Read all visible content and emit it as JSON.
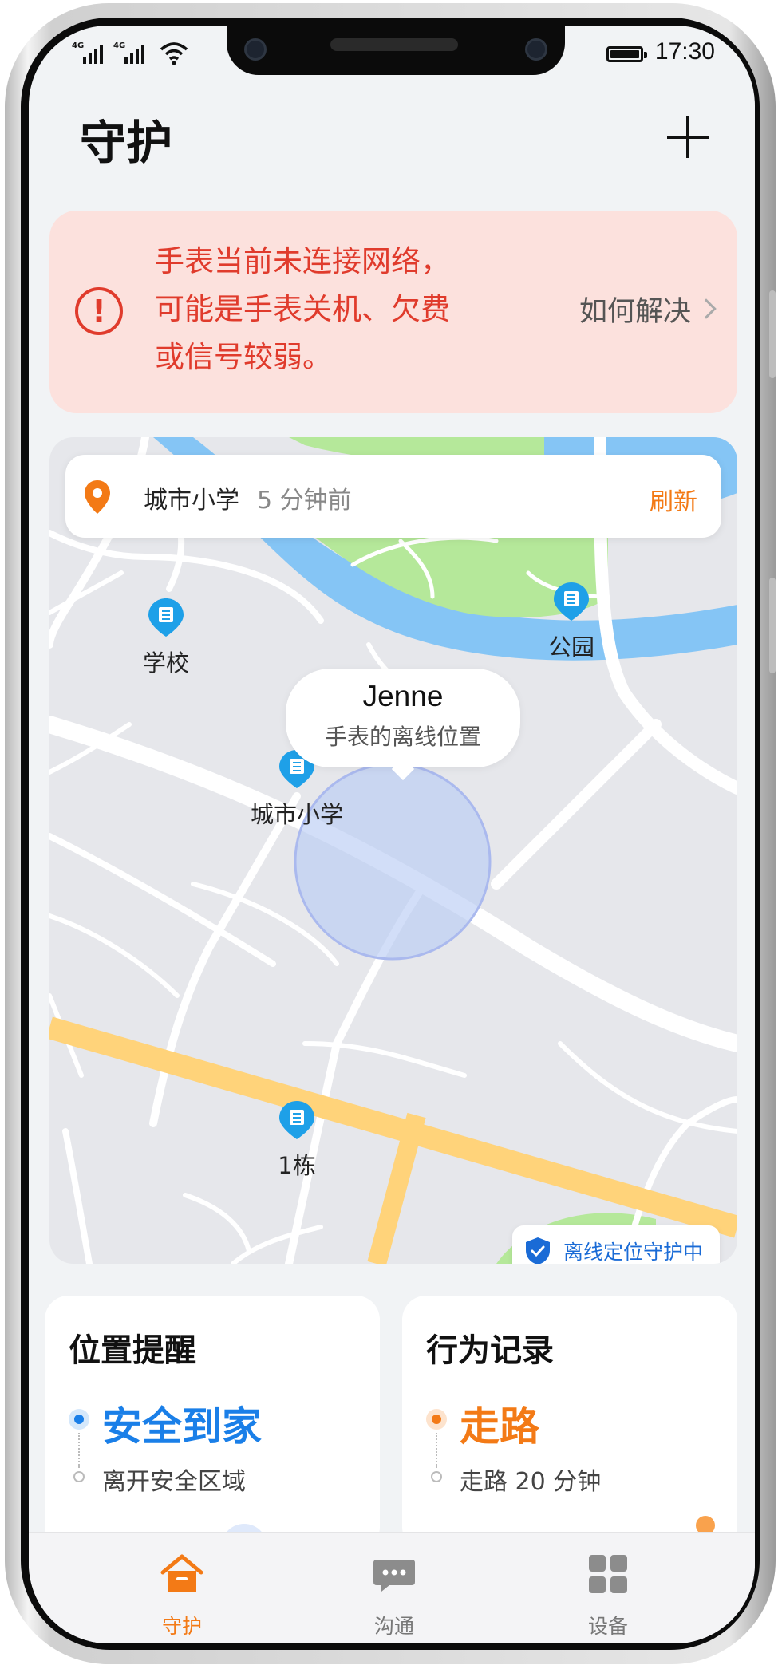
{
  "status_bar": {
    "signal_1_label": "4G",
    "signal_2_label": "4G",
    "time": "17:30"
  },
  "header": {
    "title": "守护",
    "add_icon": "plus-icon"
  },
  "alert": {
    "message": "手表当前未连接网络，可能是手表关机、欠费或信号较弱。",
    "link_label": "如何解决",
    "color": "#e03b2c",
    "background": "#fce1dd"
  },
  "map": {
    "location_bar": {
      "place": "城市小学",
      "time_ago": "5 分钟前",
      "refresh_label": "刷新"
    },
    "pois": [
      {
        "label": "学校"
      },
      {
        "label": "公园"
      },
      {
        "label": "城市小学"
      },
      {
        "label": "1栋"
      }
    ],
    "bubble": {
      "name": "Jenne",
      "subtitle": "手表的离线位置"
    },
    "guard_badge": "离线定位守护中"
  },
  "cards": [
    {
      "title": "位置提醒",
      "primary": "安全到家",
      "secondary": "离开安全区域",
      "accent": "#1a7fe8"
    },
    {
      "title": "行为记录",
      "primary": "走路",
      "secondary": "走路 20 分钟",
      "accent": "#f37a16"
    }
  ],
  "bottom_nav": {
    "items": [
      {
        "label": "守护",
        "icon": "home-icon",
        "active": true
      },
      {
        "label": "沟通",
        "icon": "chat-bubble-icon",
        "active": false
      },
      {
        "label": "设备",
        "icon": "grid-icon",
        "active": false
      }
    ],
    "active_color": "#f37a16",
    "inactive_color": "#777777"
  }
}
